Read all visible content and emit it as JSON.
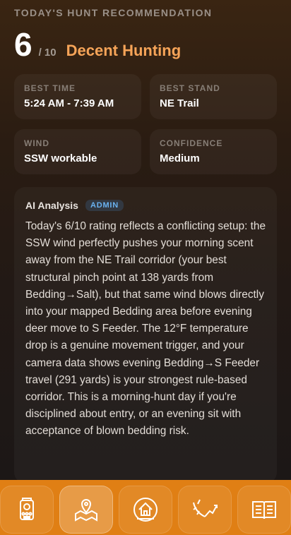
{
  "header": {
    "kicker": "TODAY'S HUNT RECOMMENDATION",
    "score": "6",
    "score_of": "/ 10",
    "rating_label": "Decent Hunting"
  },
  "stats": [
    {
      "label": "BEST TIME",
      "value": "5:24 AM - 7:39 AM"
    },
    {
      "label": "BEST STAND",
      "value": "NE Trail"
    },
    {
      "label": "WIND",
      "value": "SSW workable"
    },
    {
      "label": "CONFIDENCE",
      "value": "Medium"
    }
  ],
  "analysis": {
    "title": "AI Analysis",
    "badge": "ADMIN",
    "body": "Today's 6/10 rating reflects a conflicting setup: the SSW wind perfectly pushes your morning scent away from the NE Trail corridor (your best structural pinch point at 138 yards from Bedding→Salt), but that same wind blows directly into your mapped Bedding area before evening deer move to S Feeder. The 12°F temperature drop is a genuine movement trigger, and your camera data shows evening Bedding→S Feeder travel (291 yards) is your strongest rule-based corridor. This is a morning-hunt day if you're disciplined about entry, or an evening sit with acceptance of blown bedding risk."
  },
  "nav": {
    "icons": [
      "trail-camera-icon",
      "map-pin-icon",
      "home-stand-icon",
      "antler-trend-icon",
      "open-book-icon"
    ],
    "active_index": 1
  },
  "colors": {
    "accent": "#f6a458",
    "nav_bg": "#e07f14",
    "badge": "#6ab2f0"
  }
}
